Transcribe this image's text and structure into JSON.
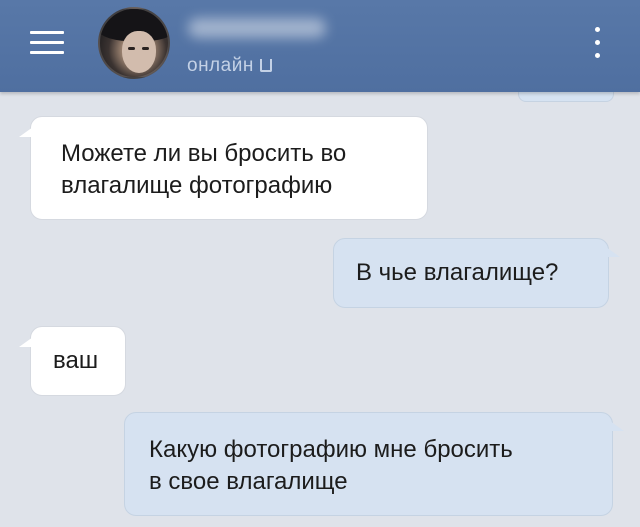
{
  "header": {
    "status_text": "онлайн",
    "menu_icon": "hamburger-menu-icon",
    "more_icon": "vertical-dots-icon",
    "status_icon": "mobile-phone-icon"
  },
  "messages": [
    {
      "from": "them",
      "lines": [
        "Можете ли вы бросить во",
        "влагалище фотографию"
      ]
    },
    {
      "from": "me",
      "lines": [
        "В чье влагалище?"
      ]
    },
    {
      "from": "them",
      "lines": [
        "ваш"
      ]
    },
    {
      "from": "me",
      "lines": [
        "Какую фотографию мне бросить",
        "в свое влагалище"
      ]
    }
  ],
  "colors": {
    "header_bg": "#5073a5",
    "chat_bg": "#dfe3ea",
    "incoming_bubble": "#ffffff",
    "outgoing_bubble": "#d6e2f1",
    "status_text": "#c3d1e6"
  }
}
